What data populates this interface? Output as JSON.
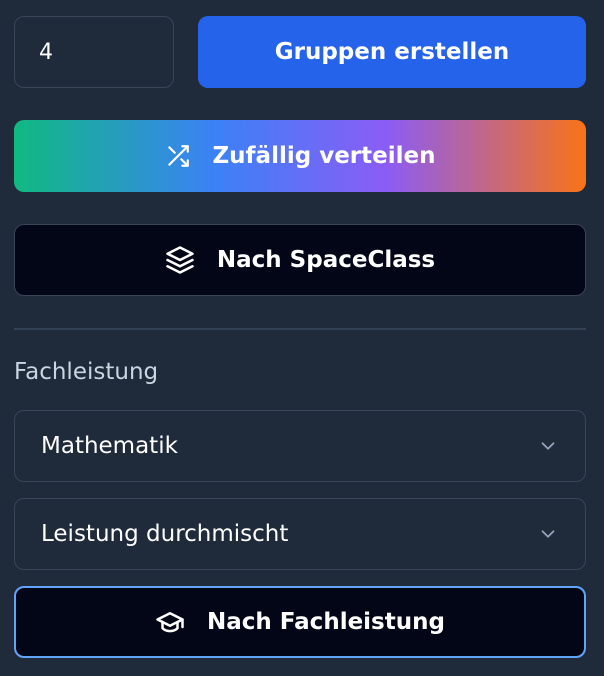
{
  "group_count": "4",
  "buttons": {
    "create": "Gruppen erstellen",
    "random": "Zufällig verteilen",
    "spaceclass": "Nach SpaceClass",
    "fachleistung": "Nach Fachleistung"
  },
  "section": {
    "label": "Fachleistung"
  },
  "selects": {
    "subject": "Mathematik",
    "mode": "Leistung durchmischt"
  },
  "icons": {
    "random": "shuffle-icon",
    "spaceclass": "layers-icon",
    "fachleistung": "graduation-cap-icon",
    "select": "chevron-down-icon"
  },
  "colors": {
    "background": "#1f2a3b",
    "primary": "#2563eb",
    "dark_button": "#020617",
    "focus_border": "#60a5fa"
  }
}
